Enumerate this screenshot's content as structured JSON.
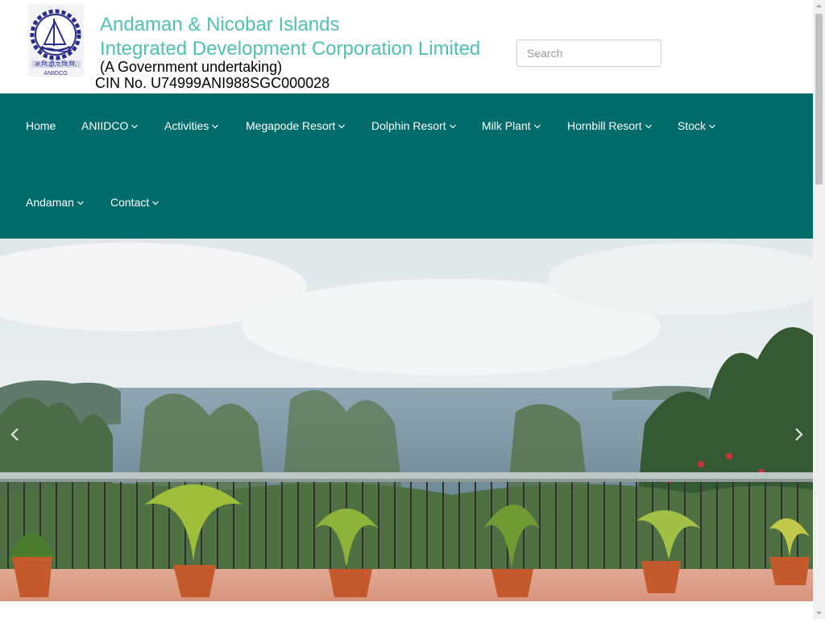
{
  "header": {
    "logo_text": "ANIIDCO",
    "title_line1": "Andaman & Nicobar Islands",
    "title_line2": "Integrated Development Corporation Limited",
    "subtitle": "(A Government undertaking)",
    "cin": "CIN No. U74999ANI988SGC000028"
  },
  "search": {
    "placeholder": "Search"
  },
  "nav": {
    "items": [
      {
        "label": "Home"
      },
      {
        "label": "ANIIDCO"
      },
      {
        "label": "Activities"
      },
      {
        "label": "Megapode Resort"
      },
      {
        "label": "Dolphin Resort"
      },
      {
        "label": "Milk Plant"
      },
      {
        "label": "Hornbill Resort"
      },
      {
        "label": "Stock"
      },
      {
        "label": "Andaman"
      },
      {
        "label": "Contact"
      }
    ]
  },
  "colors": {
    "nav_bg": "#006b6b",
    "title": "#4fc1b0"
  },
  "icons": {
    "prev": "chevron-left-icon",
    "next": "chevron-right-icon",
    "dropdown": "chevron-down-icon"
  }
}
